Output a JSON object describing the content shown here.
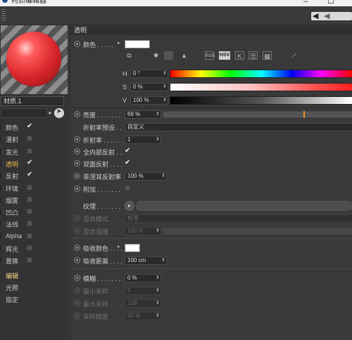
{
  "window": {
    "title": "材质编辑器",
    "minimize": "–",
    "maximize": "☐"
  },
  "nav": {
    "back": "◀",
    "forward": "◀"
  },
  "left": {
    "material_name": "材质.1",
    "channels": [
      {
        "label": "颜色",
        "checked": true,
        "active": false
      },
      {
        "label": "漫射",
        "checked": false,
        "active": false
      },
      {
        "label": "发光",
        "checked": false,
        "active": false
      },
      {
        "label": "透明",
        "checked": true,
        "active": true
      },
      {
        "label": "反射",
        "checked": true,
        "active": false
      },
      {
        "label": "环境",
        "checked": false,
        "active": false
      },
      {
        "label": "烟雾",
        "checked": false,
        "active": false
      },
      {
        "label": "凹凸",
        "checked": false,
        "active": false
      },
      {
        "label": "法线",
        "checked": false,
        "active": false
      },
      {
        "label": "Alpha",
        "checked": false,
        "active": false
      },
      {
        "label": "辉光",
        "checked": false,
        "active": false
      },
      {
        "label": "置换",
        "checked": false,
        "active": false
      }
    ],
    "links": [
      "编辑",
      "光照",
      "指定"
    ]
  },
  "section": {
    "title": "透明"
  },
  "color": {
    "label": "颜色 . . . . .",
    "hsv_tag": "HSV",
    "h_label": "H",
    "h_value": "0 °",
    "s_label": "S",
    "s_value": "0 %",
    "v_label": "V",
    "v_value": "100 %"
  },
  "params": {
    "brightness_label": "亮度 . . . . . . .",
    "brightness_value": "69 %",
    "brightness_level": 0.69,
    "ior_preset_label": "折射率预设 . .",
    "ior_preset_value": "自定义",
    "ior_label": "折射率 . . . . . .",
    "ior_value": "1",
    "total_internal_label": "全内部反射 . .",
    "double_sided_label": "双面反射 . . . .",
    "fresnel_label": "菲涅耳反射率",
    "fresnel_value": "100 %",
    "additive_label": "附加 . . . . . . .",
    "texture_label": "纹理 . . . . . . .",
    "mix_mode_label": "混合模式 . . . .",
    "mix_mode_value": "标准",
    "mix_strength_label": "混合强度 . . . .",
    "mix_strength_value": "100 %",
    "absorb_color_label": "吸收颜色 . . . .",
    "absorb_distance_label": "吸收距离 . . . .",
    "absorb_distance_value": "100 cm",
    "blur_label": "模糊 . . . . . . .",
    "blur_value": "0 %",
    "min_samples_label": "最小采样 . . . .",
    "min_samples_value": "5",
    "max_samples_label": "最大采样 . . . .",
    "max_samples_value": "128",
    "sample_accuracy_label": "采样精度 . . . .",
    "sample_accuracy_value": "50 %"
  },
  "colors": {
    "accent": "#f09020",
    "active_channel": "#f0b84b",
    "material_red": "#d8262b"
  }
}
